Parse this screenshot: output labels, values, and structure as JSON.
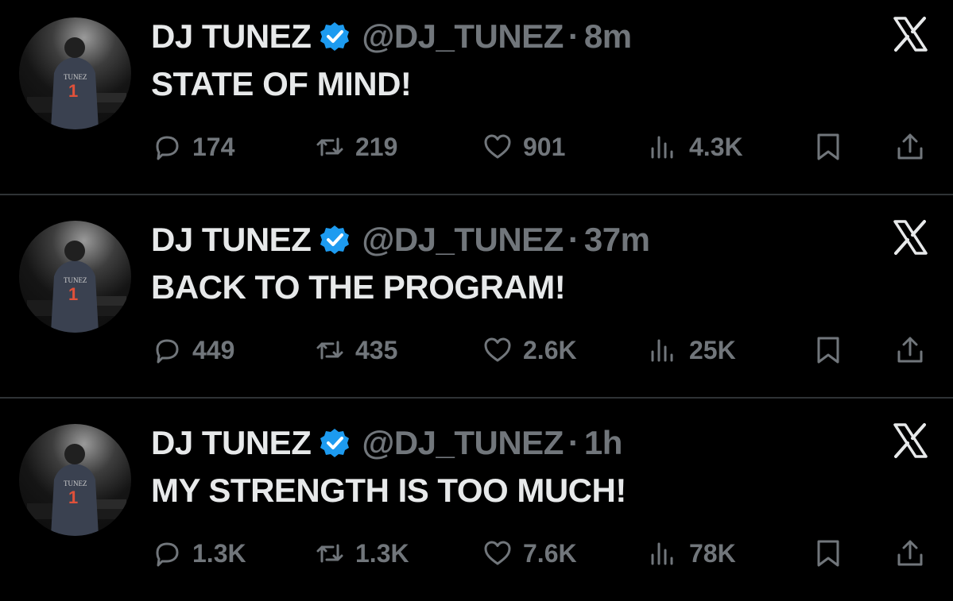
{
  "colors": {
    "background": "#000000",
    "primary_text": "#e7e9ea",
    "secondary_text": "#71767b",
    "verified_blue": "#1d9bf0",
    "divider": "#2f3336"
  },
  "icons": {
    "brand": "x-logo-icon",
    "verified": "verified-badge-icon",
    "reply": "reply-icon",
    "retweet": "retweet-icon",
    "like": "heart-icon",
    "views": "views-chart-icon",
    "bookmark": "bookmark-icon",
    "share": "share-icon"
  },
  "tweets": [
    {
      "name": "DJ TUNEZ",
      "handle": "@DJ_TUNEZ",
      "separator": "·",
      "time": "8m",
      "text": "STATE OF MIND!",
      "replies": "174",
      "retweets": "219",
      "likes": "901",
      "views": "4.3K"
    },
    {
      "name": "DJ TUNEZ",
      "handle": "@DJ_TUNEZ",
      "separator": "·",
      "time": "37m",
      "text": "BACK TO THE PROGRAM!",
      "replies": "449",
      "retweets": "435",
      "likes": "2.6K",
      "views": "25K"
    },
    {
      "name": "DJ TUNEZ",
      "handle": "@DJ_TUNEZ",
      "separator": "·",
      "time": "1h",
      "text": "MY STRENGTH IS TOO MUCH!",
      "replies": "1.3K",
      "retweets": "1.3K",
      "likes": "7.6K",
      "views": "78K"
    }
  ]
}
